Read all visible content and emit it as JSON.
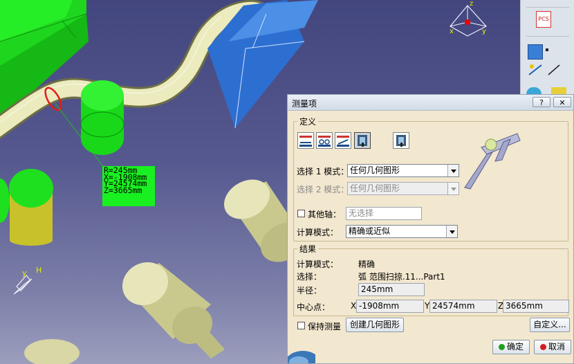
{
  "viewport": {
    "measure_label": {
      "r": "R=245mm",
      "x": "X=-1908mm",
      "y": "Y=24574mm",
      "z": "Z=3665mm"
    },
    "axis": {
      "x": "x",
      "y": "y",
      "z": "z"
    },
    "compass": {
      "y": "y",
      "h": "H"
    },
    "toolbar_pcs": "PCS"
  },
  "dialog": {
    "title": "测量项",
    "help_label": "?",
    "close_label": "✕",
    "definition": {
      "title": "定义",
      "mode_buttons": [
        {
          "name": "measure-between-icon"
        },
        {
          "name": "measure-chain-icon"
        },
        {
          "name": "measure-fan-icon"
        },
        {
          "name": "measure-item-icon",
          "active": true
        },
        {
          "name": "measure-thickness-icon"
        }
      ],
      "selection1_label": "选择 1 模式：",
      "selection1_value": "任何几何图形",
      "selection2_label": "选择 2 模式：",
      "selection2_value": "任何几何图形",
      "other_axis_label": "其他轴：",
      "other_axis_placeholder": "无选择",
      "calc_mode_label": "计算模式：",
      "calc_mode_value": "精确或近似"
    },
    "results": {
      "title": "结果",
      "calc_mode_label": "计算模式：",
      "calc_mode_value": "精确",
      "selection_label": "选择：",
      "selection_value": "弧 范围扫掠.11...Part1",
      "radius_label": "半径：",
      "radius_value": "245mm",
      "center_label": "中心点：",
      "x_label": "X",
      "x_value": "-1908mm",
      "y_label": "Y",
      "y_value": "24574mm",
      "z_label": "Z",
      "z_value": "3665mm"
    },
    "keep_measure_label": "保持测量",
    "create_geometry_label": "创建几何图形",
    "customize_label": "自定义...",
    "ok_label": "确定",
    "cancel_label": "取消"
  }
}
